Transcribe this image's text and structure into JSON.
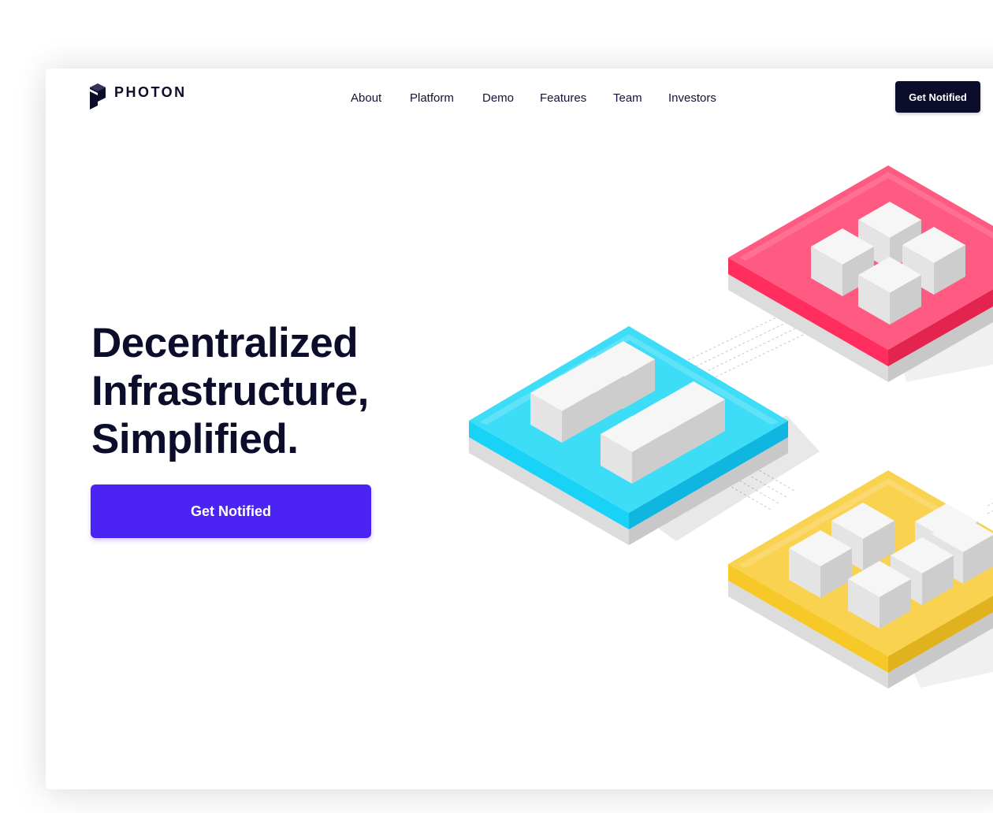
{
  "brand": {
    "name": "PHOTON",
    "logo_icon": "photon-logo-icon"
  },
  "nav": [
    {
      "label": "About"
    },
    {
      "label": "Platform"
    },
    {
      "label": "Demo"
    },
    {
      "label": "Features"
    },
    {
      "label": "Team"
    },
    {
      "label": "Investors"
    }
  ],
  "header_cta": {
    "label": "Get Notified"
  },
  "hero": {
    "lines": [
      "Decentralized",
      "Infrastructure,",
      "Simplified."
    ],
    "cta_label": "Get Notified"
  },
  "illustration": {
    "platforms": [
      {
        "name": "pink-platform",
        "color": "#ff3d6e"
      },
      {
        "name": "cyan-platform",
        "color": "#18d3f5"
      },
      {
        "name": "yellow-platform",
        "color": "#f7c928"
      }
    ]
  },
  "colors": {
    "primary": "#4b23f2",
    "dark": "#0c0c2b",
    "text": "#13133a"
  }
}
